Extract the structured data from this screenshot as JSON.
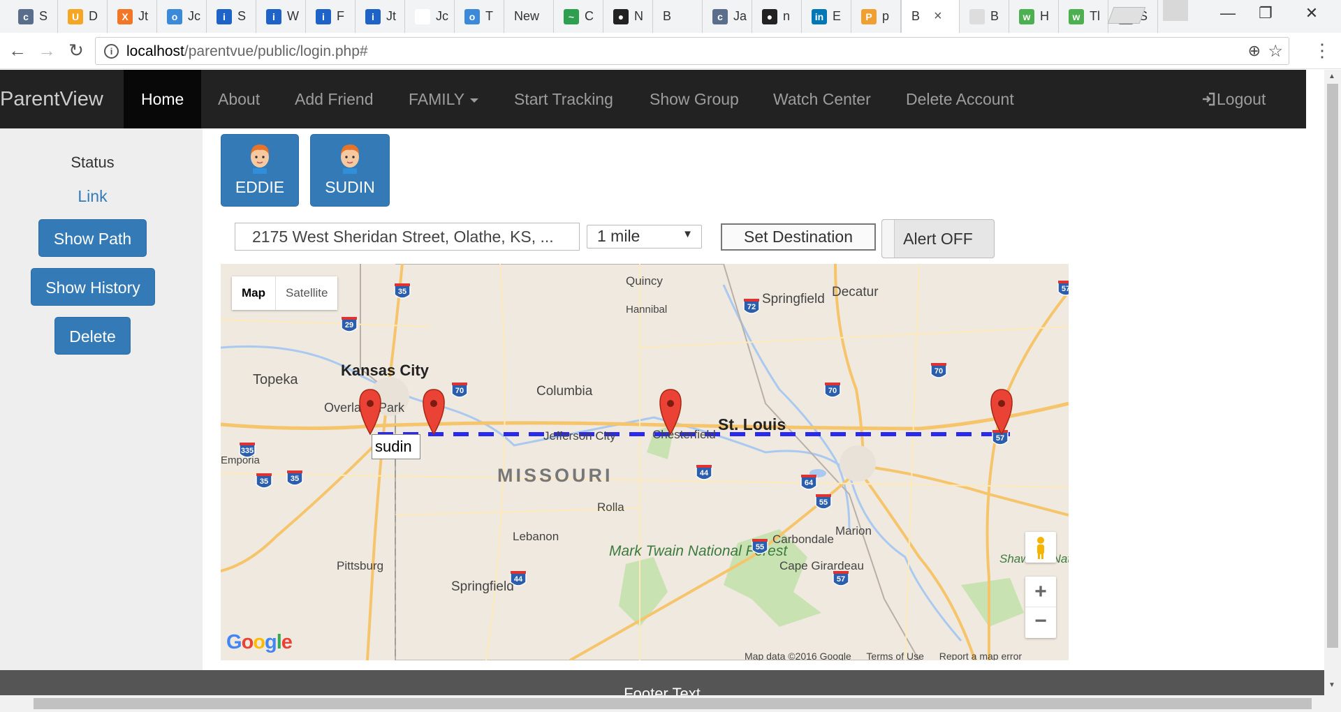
{
  "browser": {
    "tabs": [
      {
        "label": "S",
        "favicon_color": "#5a6e8c",
        "favicon_glyph": "c"
      },
      {
        "label": "D",
        "favicon_color": "#f5a623",
        "favicon_glyph": "U"
      },
      {
        "label": "Jt",
        "favicon_color": "#f37626",
        "favicon_glyph": "X"
      },
      {
        "label": "Jc",
        "favicon_color": "#3b8ad9",
        "favicon_glyph": "o"
      },
      {
        "label": "S",
        "favicon_color": "#1e64c8",
        "favicon_glyph": "i"
      },
      {
        "label": "W",
        "favicon_color": "#1e64c8",
        "favicon_glyph": "i"
      },
      {
        "label": "F",
        "favicon_color": "#1e64c8",
        "favicon_glyph": "i"
      },
      {
        "label": "Jt",
        "favicon_color": "#1e64c8",
        "favicon_glyph": "i"
      },
      {
        "label": "Jc",
        "favicon_color": "#ffffff",
        "favicon_glyph": ""
      },
      {
        "label": "T",
        "favicon_color": "#3b8ad9",
        "favicon_glyph": "o"
      },
      {
        "label": "New",
        "favicon_color": "",
        "favicon_glyph": ""
      },
      {
        "label": "C",
        "favicon_color": "#2e9e4f",
        "favicon_glyph": "~"
      },
      {
        "label": "N",
        "favicon_color": "#222222",
        "favicon_glyph": "●"
      },
      {
        "label": "B",
        "favicon_color": "",
        "favicon_glyph": ""
      },
      {
        "label": "Ja",
        "favicon_color": "#5a6e8c",
        "favicon_glyph": "c"
      },
      {
        "label": "n",
        "favicon_color": "#222222",
        "favicon_glyph": "●"
      },
      {
        "label": "E",
        "favicon_color": "#0077b5",
        "favicon_glyph": "in"
      },
      {
        "label": "p",
        "favicon_color": "#f0a030",
        "favicon_glyph": "P"
      },
      {
        "label": "B",
        "favicon_color": "",
        "favicon_glyph": ""
      },
      {
        "label": "B",
        "favicon_color": "#dddddd",
        "favicon_glyph": ""
      },
      {
        "label": "H",
        "favicon_color": "#4caf50",
        "favicon_glyph": "w"
      },
      {
        "label": "Tl",
        "favicon_color": "#4caf50",
        "favicon_glyph": "w"
      },
      {
        "label": "S",
        "favicon_color": "#666666",
        "favicon_glyph": "⚙"
      }
    ],
    "url_host": "localhost",
    "url_path": "/parentvue/public/login.php#"
  },
  "nav": {
    "brand": "ParentView",
    "items": [
      {
        "label": "Home",
        "active": true
      },
      {
        "label": "About"
      },
      {
        "label": "Add Friend"
      },
      {
        "label": "FAMILY"
      },
      {
        "label": "Start Tracking"
      },
      {
        "label": "Show Group"
      },
      {
        "label": "Watch Center"
      },
      {
        "label": "Delete Account"
      }
    ],
    "logout": "Logout"
  },
  "sidebar": {
    "status": "Status",
    "link": "Link",
    "show_path": "Show Path",
    "show_history": "Show History",
    "delete": "Delete"
  },
  "family": {
    "members": [
      "EDDIE",
      "SUDIN"
    ]
  },
  "controls": {
    "address": "2175 West Sheridan Street, Olathe, KS, ...",
    "radius": "1 mile",
    "set_destination": "Set Destination",
    "alert": "Alert OFF"
  },
  "map": {
    "type_map": "Map",
    "type_satellite": "Satellite",
    "marker_label": "sudin",
    "google": "Google",
    "attribution": [
      "Map data ©2016 Google",
      "Terms of Use",
      "Report a map error"
    ],
    "place_labels": [
      {
        "text": "Quincy"
      },
      {
        "text": "Hannibal"
      },
      {
        "text": "Springfield"
      },
      {
        "text": "Decatur"
      },
      {
        "text": "Topeka"
      },
      {
        "text": "Kansas City"
      },
      {
        "text": "Overland Park"
      },
      {
        "text": "Columbia"
      },
      {
        "text": "Jefferson City"
      },
      {
        "text": "Chesterfield"
      },
      {
        "text": "St. Louis"
      },
      {
        "text": "MISSOURI"
      },
      {
        "text": "Emporia"
      },
      {
        "text": "Rolla"
      },
      {
        "text": "Lebanon"
      },
      {
        "text": "Pittsburg"
      },
      {
        "text": "Springfield"
      },
      {
        "text": "Carbondale"
      },
      {
        "text": "Marion"
      },
      {
        "text": "Mark Twain National Forest"
      },
      {
        "text": "Cape Girardeau"
      },
      {
        "text": "Shawnee National Forest"
      }
    ],
    "highways": [
      "35",
      "29",
      "70",
      "70",
      "55",
      "70",
      "57",
      "72",
      "57",
      "335",
      "35",
      "35",
      "44",
      "64",
      "55",
      "44",
      "57"
    ]
  },
  "footer": {
    "text": "Footer Text"
  },
  "colors": {
    "nav_bg": "#222222",
    "primary": "#337ab7",
    "path_line": "#2a2aee",
    "marker": "#ea4335"
  }
}
